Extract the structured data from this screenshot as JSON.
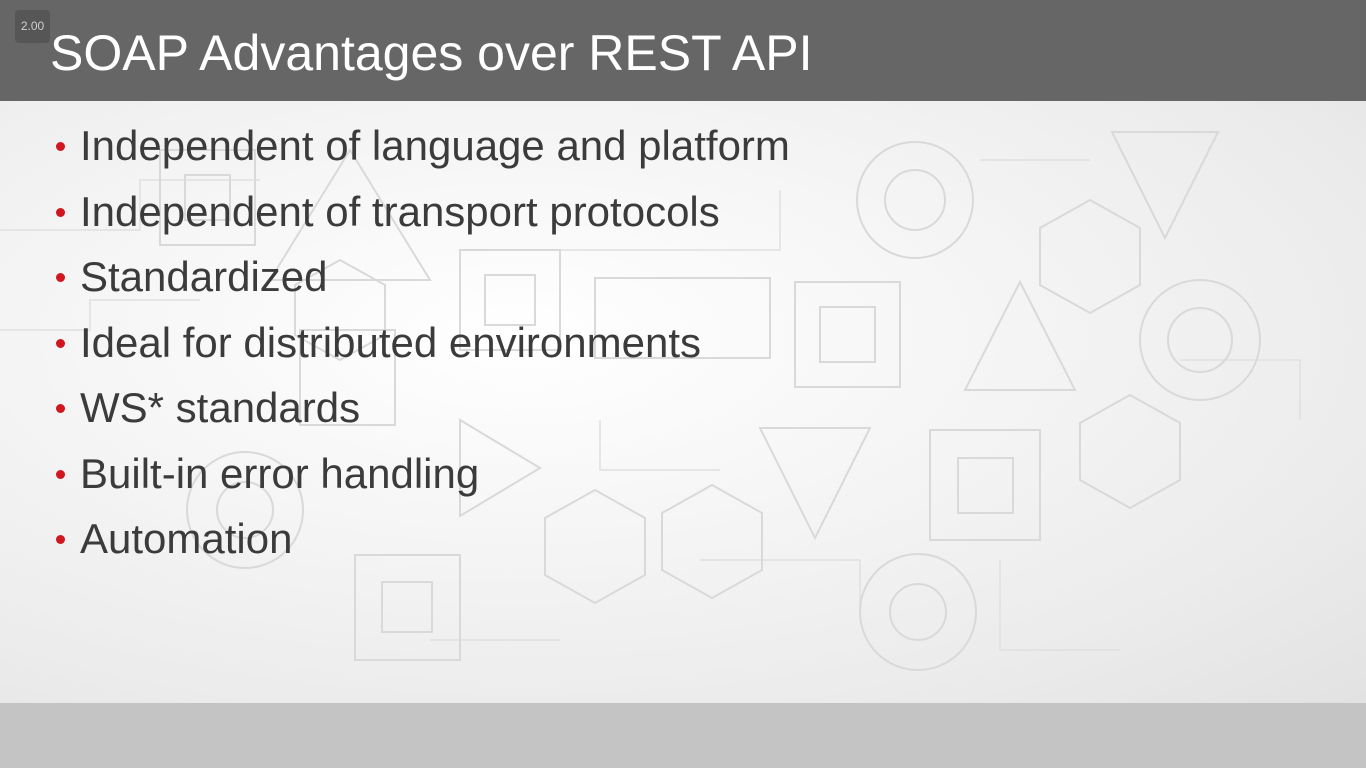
{
  "playback": {
    "speed_label": "2.00"
  },
  "slide": {
    "title": "SOAP Advantages over REST API",
    "bullets": [
      "Independent of language and platform",
      "Independent of transport protocols",
      "Standardized",
      "Ideal for distributed environments",
      "WS* standards",
      "Built-in error handling",
      "Automation"
    ]
  },
  "colors": {
    "title_bar": "#666666",
    "title_text": "#ffffff",
    "bullet_text": "#3b3b3b",
    "bullet_marker": "#d0161f",
    "bottom_bar": "#c4c4c4"
  },
  "icons": {
    "bullet_marker": "bullet-dot-icon",
    "background": "circuit-pattern-decoration"
  }
}
